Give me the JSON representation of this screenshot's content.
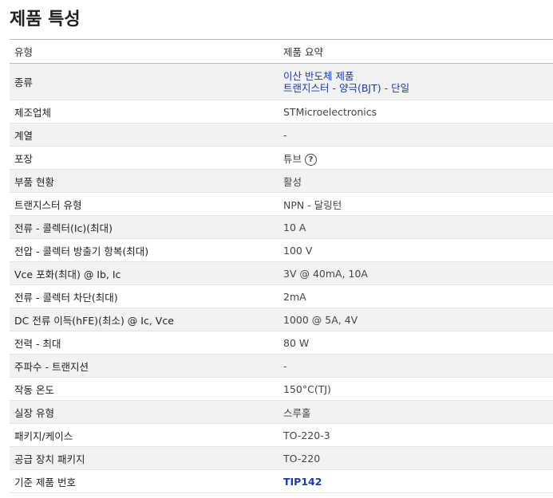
{
  "page_title": "제품 특성",
  "table": {
    "header": {
      "type": "유형",
      "summary": "제품 요약"
    },
    "rows": [
      {
        "label": "종류",
        "links": [
          "이산 반도체 제품",
          "트랜지스터 - 양극(BJT) - 단일"
        ]
      },
      {
        "label": "제조업체",
        "value": "STMicroelectronics"
      },
      {
        "label": "계열",
        "value": "-"
      },
      {
        "label": "포장",
        "value": "튜브",
        "help_icon": "question-circle-icon"
      },
      {
        "label": "부품 현황",
        "value": "활성"
      },
      {
        "label": "트랜지스터 유형",
        "value": "NPN - 달링턴"
      },
      {
        "label": "전류 - 콜렉터(Ic)(최대)",
        "value": "10 A"
      },
      {
        "label": "전압 - 콜렉터 방출기 항복(최대)",
        "value": "100 V"
      },
      {
        "label": "Vce 포화(최대) @ Ib, Ic",
        "value": "3V @ 40mA, 10A"
      },
      {
        "label": "전류 - 콜렉터 차단(최대)",
        "value": "2mA"
      },
      {
        "label": "DC 전류 이득(hFE)(최소) @ Ic, Vce",
        "value": "1000 @ 5A, 4V"
      },
      {
        "label": "전력 - 최대",
        "value": "80 W"
      },
      {
        "label": "주파수 - 트랜지션",
        "value": "-"
      },
      {
        "label": "작동 온도",
        "value": "150°C(TJ)"
      },
      {
        "label": "실장 유형",
        "value": "스루홀"
      },
      {
        "label": "패키지/케이스",
        "value": "TO-220-3"
      },
      {
        "label": "공급 장치 패키지",
        "value": "TO-220"
      },
      {
        "label": "기준 제품 번호",
        "value_link": "TIP142"
      }
    ]
  },
  "colors": {
    "link": "#1a3aaa",
    "alt_row": "#f2f2f2"
  }
}
